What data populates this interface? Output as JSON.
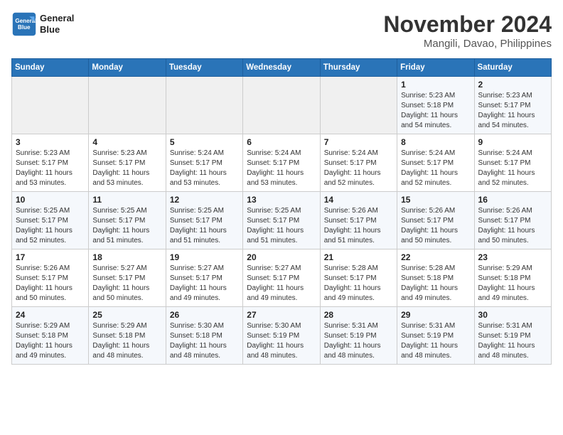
{
  "header": {
    "logo_line1": "General",
    "logo_line2": "Blue",
    "month": "November 2024",
    "location": "Mangili, Davao, Philippines"
  },
  "days_of_week": [
    "Sunday",
    "Monday",
    "Tuesday",
    "Wednesday",
    "Thursday",
    "Friday",
    "Saturday"
  ],
  "weeks": [
    [
      {
        "day": "",
        "info": ""
      },
      {
        "day": "",
        "info": ""
      },
      {
        "day": "",
        "info": ""
      },
      {
        "day": "",
        "info": ""
      },
      {
        "day": "",
        "info": ""
      },
      {
        "day": "1",
        "info": "Sunrise: 5:23 AM\nSunset: 5:18 PM\nDaylight: 11 hours and 54 minutes."
      },
      {
        "day": "2",
        "info": "Sunrise: 5:23 AM\nSunset: 5:17 PM\nDaylight: 11 hours and 54 minutes."
      }
    ],
    [
      {
        "day": "3",
        "info": "Sunrise: 5:23 AM\nSunset: 5:17 PM\nDaylight: 11 hours and 53 minutes."
      },
      {
        "day": "4",
        "info": "Sunrise: 5:23 AM\nSunset: 5:17 PM\nDaylight: 11 hours and 53 minutes."
      },
      {
        "day": "5",
        "info": "Sunrise: 5:24 AM\nSunset: 5:17 PM\nDaylight: 11 hours and 53 minutes."
      },
      {
        "day": "6",
        "info": "Sunrise: 5:24 AM\nSunset: 5:17 PM\nDaylight: 11 hours and 53 minutes."
      },
      {
        "day": "7",
        "info": "Sunrise: 5:24 AM\nSunset: 5:17 PM\nDaylight: 11 hours and 52 minutes."
      },
      {
        "day": "8",
        "info": "Sunrise: 5:24 AM\nSunset: 5:17 PM\nDaylight: 11 hours and 52 minutes."
      },
      {
        "day": "9",
        "info": "Sunrise: 5:24 AM\nSunset: 5:17 PM\nDaylight: 11 hours and 52 minutes."
      }
    ],
    [
      {
        "day": "10",
        "info": "Sunrise: 5:25 AM\nSunset: 5:17 PM\nDaylight: 11 hours and 52 minutes."
      },
      {
        "day": "11",
        "info": "Sunrise: 5:25 AM\nSunset: 5:17 PM\nDaylight: 11 hours and 51 minutes."
      },
      {
        "day": "12",
        "info": "Sunrise: 5:25 AM\nSunset: 5:17 PM\nDaylight: 11 hours and 51 minutes."
      },
      {
        "day": "13",
        "info": "Sunrise: 5:25 AM\nSunset: 5:17 PM\nDaylight: 11 hours and 51 minutes."
      },
      {
        "day": "14",
        "info": "Sunrise: 5:26 AM\nSunset: 5:17 PM\nDaylight: 11 hours and 51 minutes."
      },
      {
        "day": "15",
        "info": "Sunrise: 5:26 AM\nSunset: 5:17 PM\nDaylight: 11 hours and 50 minutes."
      },
      {
        "day": "16",
        "info": "Sunrise: 5:26 AM\nSunset: 5:17 PM\nDaylight: 11 hours and 50 minutes."
      }
    ],
    [
      {
        "day": "17",
        "info": "Sunrise: 5:26 AM\nSunset: 5:17 PM\nDaylight: 11 hours and 50 minutes."
      },
      {
        "day": "18",
        "info": "Sunrise: 5:27 AM\nSunset: 5:17 PM\nDaylight: 11 hours and 50 minutes."
      },
      {
        "day": "19",
        "info": "Sunrise: 5:27 AM\nSunset: 5:17 PM\nDaylight: 11 hours and 49 minutes."
      },
      {
        "day": "20",
        "info": "Sunrise: 5:27 AM\nSunset: 5:17 PM\nDaylight: 11 hours and 49 minutes."
      },
      {
        "day": "21",
        "info": "Sunrise: 5:28 AM\nSunset: 5:17 PM\nDaylight: 11 hours and 49 minutes."
      },
      {
        "day": "22",
        "info": "Sunrise: 5:28 AM\nSunset: 5:18 PM\nDaylight: 11 hours and 49 minutes."
      },
      {
        "day": "23",
        "info": "Sunrise: 5:29 AM\nSunset: 5:18 PM\nDaylight: 11 hours and 49 minutes."
      }
    ],
    [
      {
        "day": "24",
        "info": "Sunrise: 5:29 AM\nSunset: 5:18 PM\nDaylight: 11 hours and 49 minutes."
      },
      {
        "day": "25",
        "info": "Sunrise: 5:29 AM\nSunset: 5:18 PM\nDaylight: 11 hours and 48 minutes."
      },
      {
        "day": "26",
        "info": "Sunrise: 5:30 AM\nSunset: 5:18 PM\nDaylight: 11 hours and 48 minutes."
      },
      {
        "day": "27",
        "info": "Sunrise: 5:30 AM\nSunset: 5:19 PM\nDaylight: 11 hours and 48 minutes."
      },
      {
        "day": "28",
        "info": "Sunrise: 5:31 AM\nSunset: 5:19 PM\nDaylight: 11 hours and 48 minutes."
      },
      {
        "day": "29",
        "info": "Sunrise: 5:31 AM\nSunset: 5:19 PM\nDaylight: 11 hours and 48 minutes."
      },
      {
        "day": "30",
        "info": "Sunrise: 5:31 AM\nSunset: 5:19 PM\nDaylight: 11 hours and 48 minutes."
      }
    ]
  ]
}
